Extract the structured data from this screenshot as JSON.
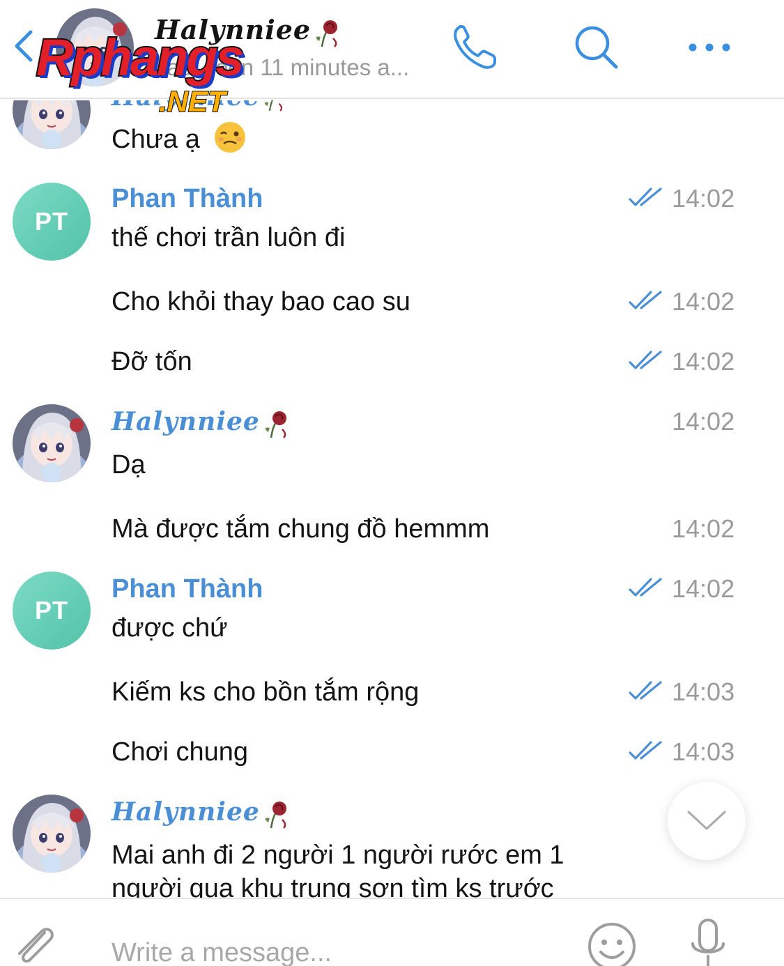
{
  "header": {
    "contact_name": "Halynniee",
    "status": "last seen 11 minutes a..."
  },
  "watermark": {
    "brand": "Rphangs",
    "suffix": ".NET"
  },
  "messages": {
    "m0": {
      "text": "Chưa ạ"
    },
    "g1": {
      "sender": "Phan Thành",
      "initials": "PT",
      "text": "thế chơi trần luôn đi",
      "time": "14:02"
    },
    "m2": {
      "text": "Cho khỏi thay bao cao su",
      "time": "14:02"
    },
    "m3": {
      "text": "Đỡ tốn",
      "time": "14:02"
    },
    "g2": {
      "sender": "Halynniee",
      "text": "Dạ",
      "time": "14:02"
    },
    "m5": {
      "text": "Mà được tắm chung đồ hemmm",
      "time": "14:02"
    },
    "g3": {
      "sender": "Phan Thành",
      "initials": "PT",
      "text": "được chứ",
      "time": "14:02"
    },
    "m7": {
      "text": "Kiếm ks cho bồn tắm rộng",
      "time": "14:03"
    },
    "m8": {
      "text": "Chơi chung",
      "time": "14:03"
    },
    "g4": {
      "sender": "Halynniee",
      "text": "Mai anh đi 2 người 1 người rước em 1",
      "text2": "người qua khu trung sơn tìm ks trước"
    }
  },
  "composer": {
    "placeholder": "Write a message..."
  },
  "colors": {
    "accent": "#4a8fd6",
    "time": "#9b9b9b",
    "pt_avatar": "#5ec9b0"
  },
  "icons": [
    "back-chevron-icon",
    "phone-icon",
    "search-icon",
    "more-icon",
    "double-check-icon",
    "chevron-down-icon",
    "paperclip-icon",
    "emoji-icon",
    "microphone-icon",
    "rose-icon"
  ]
}
